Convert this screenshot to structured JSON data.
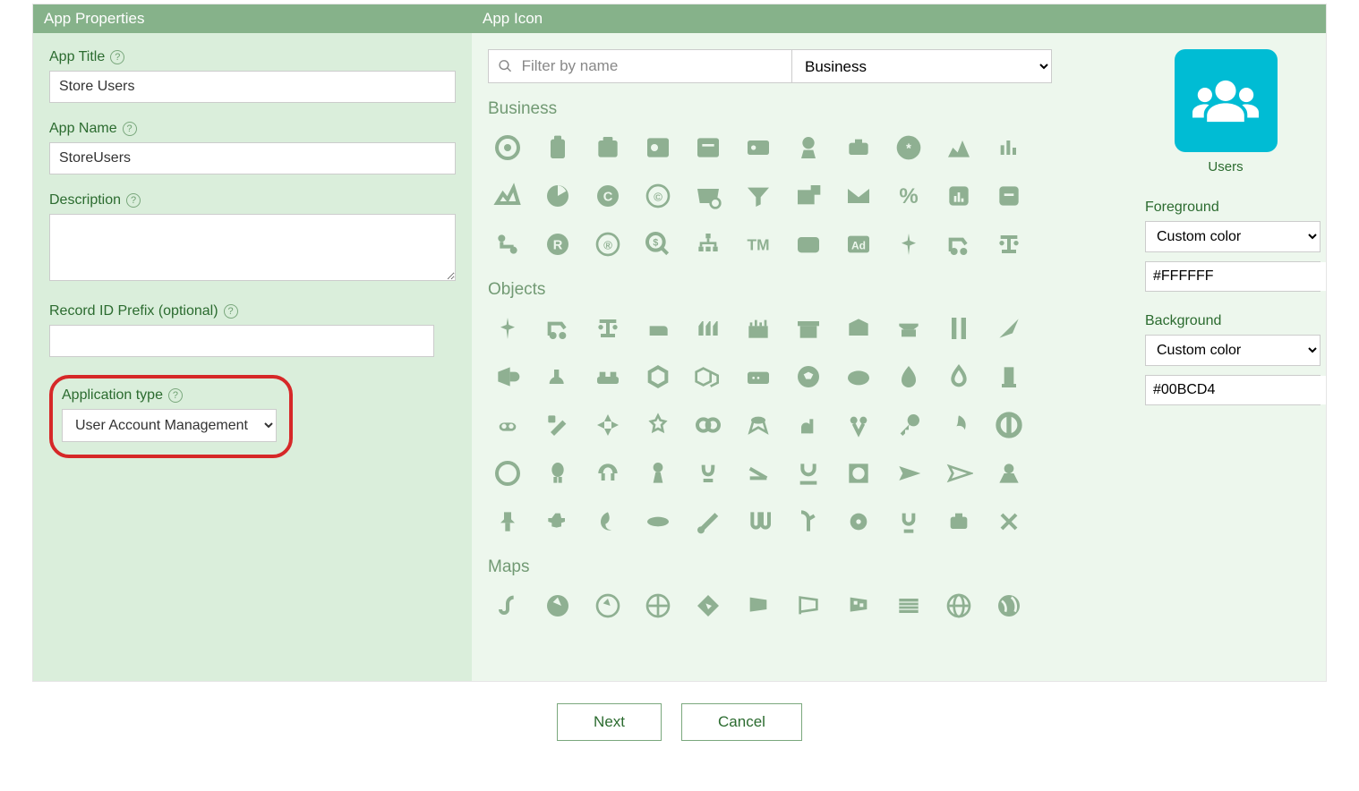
{
  "left": {
    "header": "App Properties",
    "appTitleLabel": "App Title",
    "appTitleValue": "Store Users",
    "appNameLabel": "App Name",
    "appNameValue": "StoreUsers",
    "descriptionLabel": "Description",
    "descriptionValue": "",
    "recordIdLabel": "Record ID Prefix (optional)",
    "recordIdValue": "",
    "appTypeLabel": "Application type",
    "appTypeValue": "User Account Management"
  },
  "right": {
    "header": "App Icon",
    "filterPlaceholder": "Filter by name",
    "categoryFilter": "Business",
    "cat1": "Business",
    "cat2": "Objects",
    "cat3": "Maps",
    "previewName": "Users",
    "fgLabel": "Foreground",
    "fgSelect": "Custom color",
    "fgHex": "#FFFFFF",
    "bgLabel": "Background",
    "bgSelect": "Custom color",
    "bgHex": "#00BCD4"
  },
  "footer": {
    "next": "Next",
    "cancel": "Cancel"
  },
  "swatchFg": "#FFFFFF",
  "swatchBg": "#00BCD4"
}
